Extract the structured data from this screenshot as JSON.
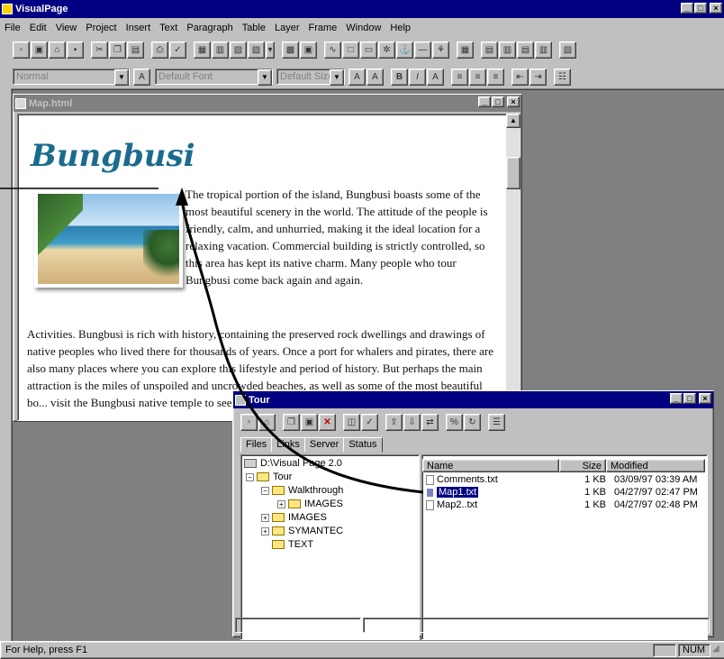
{
  "app": {
    "title": "VisualPage",
    "menu": [
      "File",
      "Edit",
      "View",
      "Project",
      "Insert",
      "Text",
      "Paragraph",
      "Table",
      "Layer",
      "Frame",
      "Window",
      "Help"
    ],
    "format_bar": {
      "paragraph_style": "Normal",
      "font": "Default Font",
      "size": "Default Size"
    },
    "status": {
      "help": "For Help, press F1",
      "num": "NUM"
    }
  },
  "doc_window": {
    "title": "Map.html",
    "logo": "Bungbusi",
    "para1": "The tropical portion of the island, Bungbusi boasts some of the most beautiful scenery in the world. The attitude of the people is friendly, calm, and unhurried, making it the ideal location for a relaxing vacation. Commercial building is strictly controlled, so this area has kept its native charm. Many people who tour Bungbusi come back again and again.",
    "para2": "Activities. Bungbusi is rich with history, containing the preserved rock dwellings and drawings of native peoples who lived there for thousands of years. Once a port for whalers and pirates, there are also many places where you can explore this lifestyle and period of history. But perhaps the main attraction is the miles of unspoiled and uncrowded beaches, as well as some of the most beautiful bo... visit the Bungbusi native temple to see th..."
  },
  "tour_window": {
    "title": "Tour",
    "tabs": [
      "Files",
      "Links",
      "Server",
      "Status"
    ],
    "active_tab": "Files",
    "tree": {
      "root": "D:\\Visual Page 2.0",
      "tour": "Tour",
      "walkthrough": "Walkthrough",
      "walk_images": "IMAGES",
      "images": "IMAGES",
      "symantec": "SYMANTEC",
      "text": "TEXT"
    },
    "columns": {
      "name": "Name",
      "size": "Size",
      "modified": "Modified"
    },
    "files": [
      {
        "name": "Comments.txt",
        "size": "1 KB",
        "modified": "03/09/97 03:39 AM"
      },
      {
        "name": "Map1.txt",
        "size": "1 KB",
        "modified": "04/27/97 02:47 PM"
      },
      {
        "name": "Map2..txt",
        "size": "1 KB",
        "modified": "04/27/97 02:48 PM"
      }
    ],
    "selected_file": "Map1.txt"
  },
  "colors": {
    "title_active": "#000080",
    "title_inactive": "#808080",
    "face": "#c0c0c0",
    "logo": "#1a6b8e"
  }
}
